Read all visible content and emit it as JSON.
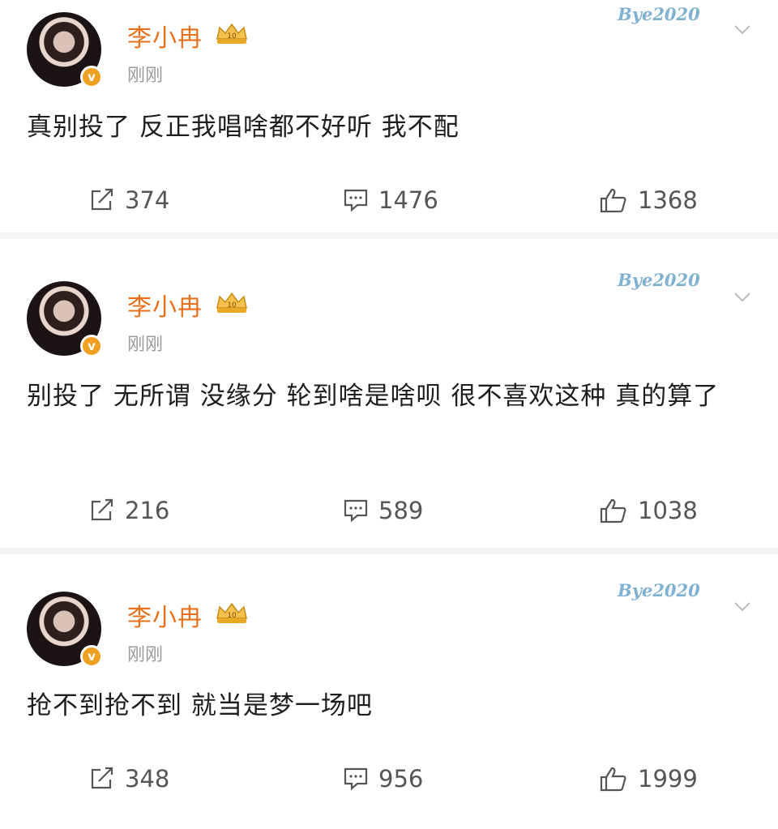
{
  "posts": [
    {
      "author": "李小冉",
      "time": "刚刚",
      "badge": "v",
      "watermark": "Bye2020",
      "text": "真别投了 反正我唱啥都不好听 我不配",
      "reposts": "374",
      "comments": "1476",
      "likes": "1368"
    },
    {
      "author": "李小冉",
      "time": "刚刚",
      "badge": "v",
      "watermark": "Bye2020",
      "text": "别投了 无所谓 没缘分 轮到啥是啥呗 很不喜欢这种 真的算了",
      "reposts": "216",
      "comments": "589",
      "likes": "1038"
    },
    {
      "author": "李小冉",
      "time": "刚刚",
      "badge": "v",
      "watermark": "Bye2020",
      "text": "抢不到抢不到 就当是梦一场吧",
      "reposts": "348",
      "comments": "956",
      "likes": "1999"
    }
  ],
  "icons": {
    "repost": "repost-icon",
    "comment": "comment-icon",
    "like": "like-icon",
    "menu": "chevron-down-icon",
    "vip": "crown-icon"
  },
  "colors": {
    "name": "#e8701a",
    "badge": "#f0a020",
    "meta": "#9a9a9a",
    "watermark": "#7fb2d0"
  }
}
